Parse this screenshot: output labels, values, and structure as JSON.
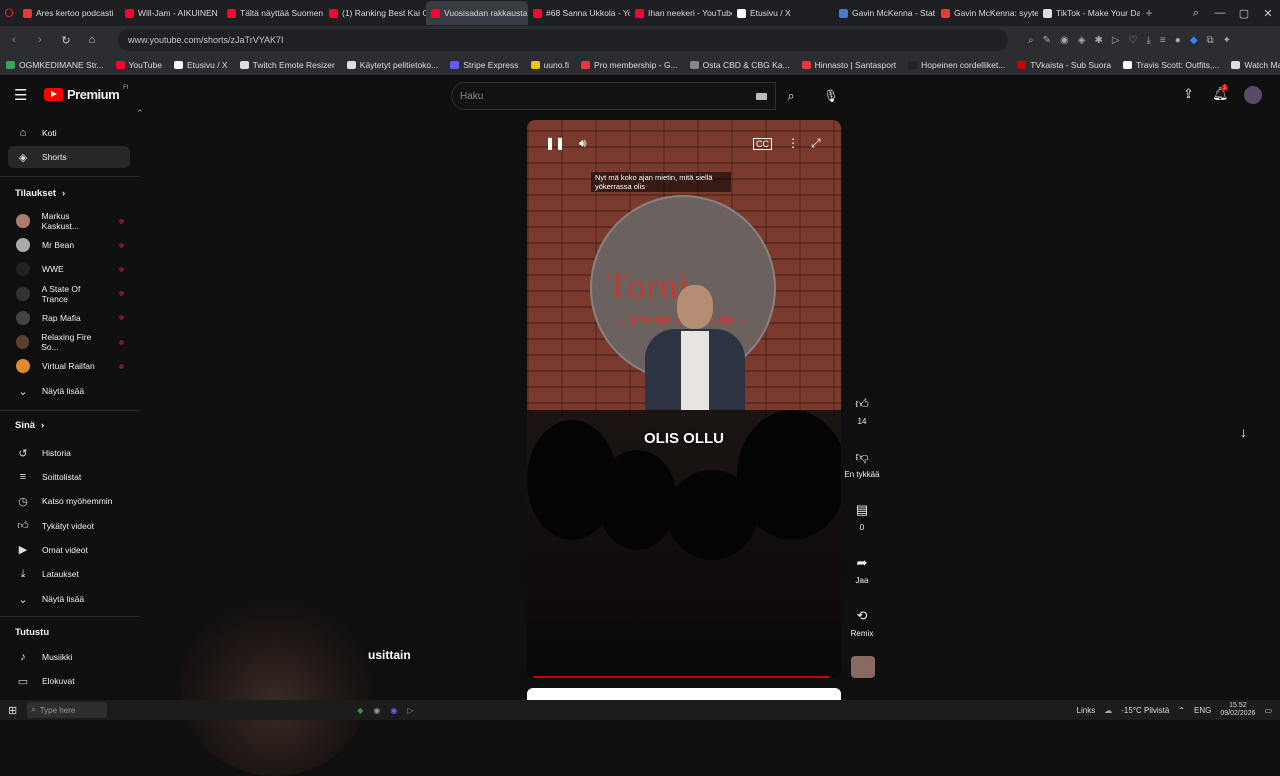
{
  "tabs": [
    {
      "label": "Ares kertoo podcasti",
      "color": "#e53935"
    },
    {
      "label": "Will-Jam - AIKUINEN",
      "color": "#ff0033"
    },
    {
      "label": "Tältä näyttää Suomen",
      "color": "#ff0033"
    },
    {
      "label": "(1) Ranking Best Kai C",
      "color": "#ff0033"
    },
    {
      "label": "Vuosisadan rakkausta",
      "color": "#ff0033",
      "active": true
    },
    {
      "label": "#68 Sanna Ukkola - Yo",
      "color": "#ff0033"
    },
    {
      "label": "Ihan neekeri - YouTube",
      "color": "#ff0033"
    },
    {
      "label": "Etusivu / X",
      "color": "#ffffff"
    },
    {
      "label": "Gavin McKenna - Stat",
      "color": "#4a7bd0"
    },
    {
      "label": "Gavin McKenna: syyte",
      "color": "#e53935"
    },
    {
      "label": "TikTok - Make Your Da",
      "color": "#dddddd"
    }
  ],
  "browser": {
    "url": "www.youtube.com/shorts/zJaTrVYAK7I"
  },
  "bookmarks": [
    {
      "label": "OGMKEDIMANE Str...",
      "color": "#3aa55a"
    },
    {
      "label": "YouTube",
      "color": "#ff0033"
    },
    {
      "label": "Etusivu / X",
      "color": "#ffffff"
    },
    {
      "label": "Twitch Emote Resizer",
      "color": "#dddddd"
    },
    {
      "label": "Käytetyt pelitietoko...",
      "color": "#dddddd"
    },
    {
      "label": "Stripe Express",
      "color": "#635bff"
    },
    {
      "label": "uuno.fi",
      "color": "#f5c400"
    },
    {
      "label": "Pro membership - G...",
      "color": "#e53935"
    },
    {
      "label": "Osta CBD & CBG Ka...",
      "color": "#888888"
    },
    {
      "label": "Hinnasto | Santasport",
      "color": "#e53935"
    },
    {
      "label": "Hopeinen cordelliket...",
      "color": "#222222"
    },
    {
      "label": "TVkaista - Sub Suora",
      "color": "#cc0000"
    },
    {
      "label": "Travis Scott: Outfits,...",
      "color": "#ffffff"
    },
    {
      "label": "Watch Marvel's Luk...",
      "color": "#dddddd"
    }
  ],
  "yt": {
    "brand": "Premium",
    "brand_sup": "FI",
    "search_placeholder": "Haku",
    "notif_count": "2",
    "nav": [
      {
        "label": "Koti",
        "icon": "home-icon"
      },
      {
        "label": "Shorts",
        "icon": "shorts-icon"
      }
    ],
    "subs_header": "Tilaukset",
    "subs": [
      {
        "label": "Markus Kaskust...",
        "color": "#b07a70"
      },
      {
        "label": "Mr Bean",
        "color": "#aaaaaa"
      },
      {
        "label": "WWE",
        "color": "#222222"
      },
      {
        "label": "A State Of Trance",
        "color": "#333333"
      },
      {
        "label": "Rap Mafia",
        "color": "#444444"
      },
      {
        "label": "Relaxing Fire So...",
        "color": "#5a4030"
      },
      {
        "label": "Virtual Railfan",
        "color": "#e08a30"
      }
    ],
    "subs_more": "Näytä lisää",
    "you_header": "Sinä",
    "you": [
      {
        "label": "Historia",
        "icon": "history-icon"
      },
      {
        "label": "Soittolistat",
        "icon": "playlist-icon"
      },
      {
        "label": "Katso myöhemmin",
        "icon": "clock-icon"
      },
      {
        "label": "Tykätyt videot",
        "icon": "like-icon"
      },
      {
        "label": "Omat videot",
        "icon": "video-icon"
      },
      {
        "label": "Lataukset",
        "icon": "download-icon"
      }
    ],
    "you_more": "Näytä lisää",
    "explore_header": "Tutustu",
    "explore": [
      {
        "label": "Musiikki",
        "icon": "music-icon"
      },
      {
        "label": "Elokuvat",
        "icon": "film-icon"
      }
    ]
  },
  "short": {
    "caption_top": "Nyt mä koko ajan mietin, mitä siellä yökerrassa olis",
    "caption_big": "OLIS OLLU",
    "sign_text": "Torni",
    "sign_sub": "- STAND UP KLUBI -",
    "likes": "14",
    "dislike_label": "En tykkää",
    "comments": "0",
    "share_label": "Jaa",
    "remix_label": "Remix",
    "progress": 0.98
  },
  "overlay_text": "usittain",
  "taskbar": {
    "search": "Type here",
    "links": "Links",
    "weather": "-15°C Pilvistä",
    "lang": "ENG",
    "time": "15.52",
    "date": "09/02/2026"
  }
}
